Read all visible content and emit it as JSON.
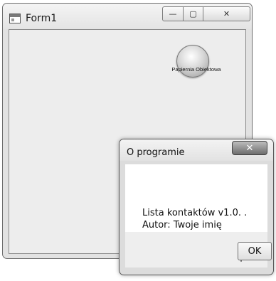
{
  "main_window": {
    "title": "Form1",
    "min_glyph": "—",
    "max_glyph": "▢",
    "close_glyph": "✕",
    "orb_label": "Papiernia Obiektowa"
  },
  "dialog": {
    "title": "O programie",
    "close_glyph": "✕",
    "message_line1": "Lista kontaktów v1.0. .",
    "message_line2": "Autor: Twoje imię",
    "ok_label": "OK"
  }
}
